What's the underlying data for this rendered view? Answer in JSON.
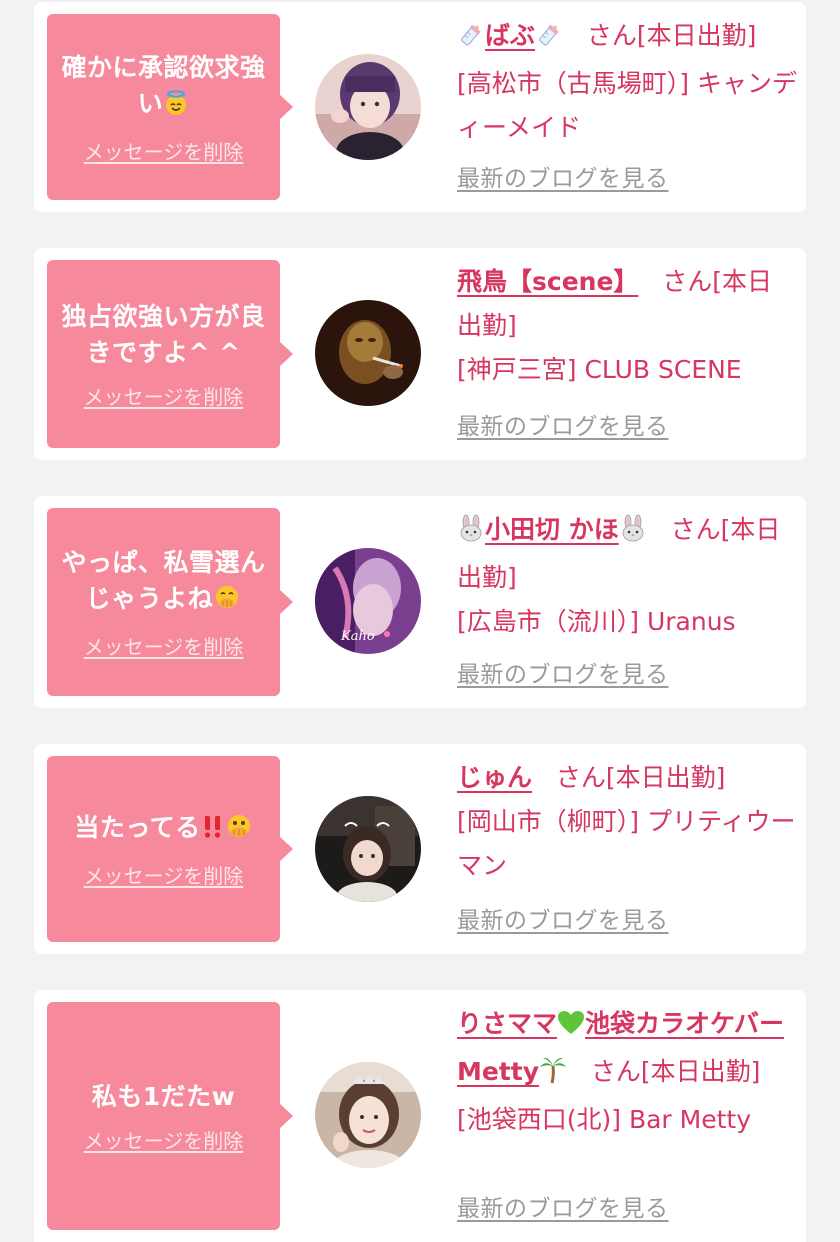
{
  "colors": {
    "page_background": "#f2f2f2",
    "card_background": "#ffffff",
    "bubble_background": "#f7899c",
    "link_pink": "#d6365f",
    "blog_gray": "#9a9a9a"
  },
  "items": [
    {
      "message": "確かに承認欲求強い",
      "message_emoji": "smiling-face-with-halo-icon",
      "delete_label": "メッセージを削除",
      "name_prefix_emoji": "baby-bottle-icon",
      "name": "ばぶ",
      "name_suffix_emoji": "baby-bottle-icon",
      "honorific": "さん",
      "status": "[本日出勤]",
      "shop": "[高松市（古馬場町）] キャンディーメイド",
      "blog_link": "最新のブログを見る"
    },
    {
      "message": "独占欲強い方が良きですよ^ ^",
      "message_emoji": "",
      "delete_label": "メッセージを削除",
      "name_prefix_emoji": "",
      "name": "飛鳥【scene】",
      "name_suffix_emoji": "",
      "honorific": "さん",
      "status": "[本日出勤]",
      "shop": "[神戸三宮] CLUB SCENE",
      "blog_link": "最新のブログを見る"
    },
    {
      "message": "やっぱ、私雪選んじゃうよね",
      "message_emoji": "face-with-hand-over-mouth-icon",
      "delete_label": "メッセージを削除",
      "name_prefix_emoji": "rabbit-face-icon",
      "name": "小田切 かほ",
      "name_suffix_emoji": "rabbit-face-icon",
      "honorific": "さん",
      "status": "[本日出勤]",
      "shop": "[広島市（流川）] Uranus",
      "blog_link": "最新のブログを見る"
    },
    {
      "message": "当たってる",
      "message_emoji": "double-exclamation-and-peeking-face-icon",
      "delete_label": "メッセージを削除",
      "name_prefix_emoji": "",
      "name": "じゅん",
      "name_suffix_emoji": "",
      "honorific": "さん",
      "status": "[本日出勤]",
      "shop": "[岡山市（柳町）] プリティウーマン",
      "blog_link": "最新のブログを見る"
    },
    {
      "message": "私も1だたw",
      "message_emoji": "",
      "delete_label": "メッセージを削除",
      "name_prefix_emoji": "",
      "name_part1": "りさママ",
      "name_mid_emoji": "green-heart-icon",
      "name_part2": "池袋カラオケバーMetty",
      "name_suffix_emoji": "palm-tree-icon",
      "honorific": "さん",
      "status": "[本日出勤]",
      "shop": "[池袋西口(北)] Bar Metty",
      "blog_link": "最新のブログを見る"
    }
  ]
}
